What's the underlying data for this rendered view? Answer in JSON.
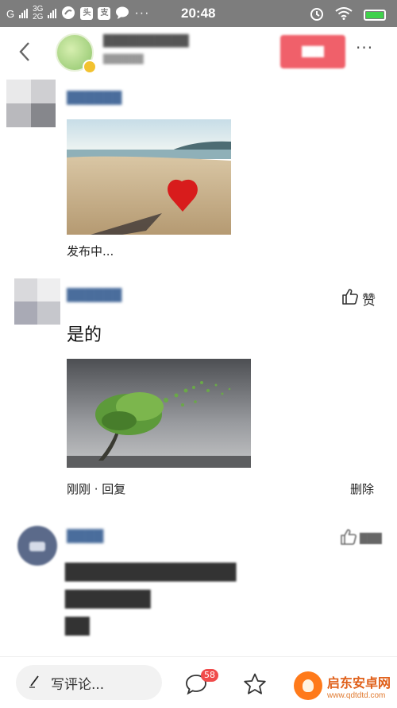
{
  "statusbar": {
    "carrier1": "G",
    "net_top": "3G",
    "net_bottom": "2G",
    "app_icon_1": "头条",
    "app_icon_2": "支",
    "time": "20:48",
    "icons": [
      "signal-icon",
      "chat-icon",
      "alarm-icon",
      "wifi-icon",
      "battery-icon"
    ]
  },
  "header": {
    "channel_name": "██████████",
    "channel_sub": "██████",
    "follow_label": "███",
    "more_label": "···"
  },
  "comments": [
    {
      "username": "██████",
      "status_text": "发布中..."
    },
    {
      "username": "██████",
      "text": "是的",
      "like_label": "赞",
      "meta_text": "刚刚 · 回复",
      "delete_label": "删除"
    },
    {
      "username": "████",
      "like_count": "███",
      "text_lines": [
        "██████████████",
        "███████",
        "██"
      ]
    }
  ],
  "bottombar": {
    "write_placeholder": "写评论...",
    "comment_count": "58"
  },
  "watermark": {
    "name": "启东安卓网",
    "url": "www.qdtdtd.com"
  }
}
